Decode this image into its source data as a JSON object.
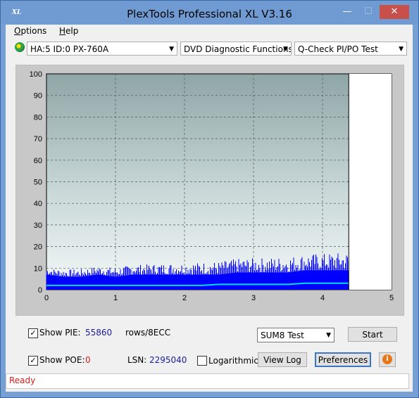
{
  "window": {
    "title": "PlexTools Professional XL V3.16",
    "app_icon": "XL"
  },
  "menu": {
    "items": [
      {
        "label": "Options",
        "mnemonic": "O"
      },
      {
        "label": "Help",
        "mnemonic": "H"
      }
    ]
  },
  "toolbar": {
    "drive": "HA:5 ID:0  PX-760A",
    "function": "DVD Diagnostic Functions",
    "test": "Q-Check PI/PO Test"
  },
  "chart_data": {
    "type": "area",
    "x_ticks": [
      "0",
      "1",
      "2",
      "3",
      "4",
      "5"
    ],
    "y_ticks": [
      "0",
      "10",
      "20",
      "30",
      "40",
      "50",
      "60",
      "70",
      "80",
      "90",
      "100"
    ],
    "xlim": [
      0,
      5
    ],
    "ylim": [
      0,
      100
    ],
    "grid": true,
    "end_marker_x": 4.38,
    "series": [
      {
        "color": "#0000ff",
        "x": [
          0.0,
          0.25,
          0.5,
          0.75,
          1.0,
          1.25,
          1.5,
          1.75,
          2.0,
          2.25,
          2.5,
          2.75,
          3.0,
          3.25,
          3.5,
          3.75,
          4.0,
          4.25,
          4.38
        ],
        "values": [
          7,
          6,
          6,
          7,
          6,
          7,
          7,
          7,
          7,
          7,
          7,
          8,
          8,
          8,
          8,
          9,
          9,
          9,
          9
        ]
      },
      {
        "color": "#00ddee",
        "x": [
          0.0,
          0.25,
          0.5,
          0.75,
          1.0,
          1.25,
          1.5,
          1.75,
          2.0,
          2.25,
          2.5,
          2.75,
          3.0,
          3.25,
          3.5,
          3.75,
          4.0,
          4.25,
          4.38
        ],
        "values": [
          2,
          2,
          2,
          2,
          2,
          2,
          2,
          2,
          2,
          2,
          2.5,
          2.5,
          2.5,
          2.5,
          2.5,
          3,
          3,
          3,
          3
        ]
      }
    ]
  },
  "panel": {
    "show_pie_label": "Show PIE:",
    "pie_value": "55860",
    "pie_unit": "rows/8ECC",
    "show_poe_label": "Show POE:",
    "poe_value": "0",
    "lsn_label": "LSN:",
    "lsn_value": "2295040",
    "log_label": "Logarithmic",
    "sum_select": "SUM8 Test",
    "start": "Start",
    "view_log": "View Log",
    "preferences": "Preferences",
    "show_pie_checked": "✓",
    "show_poe_checked": "✓"
  },
  "status": "Ready"
}
